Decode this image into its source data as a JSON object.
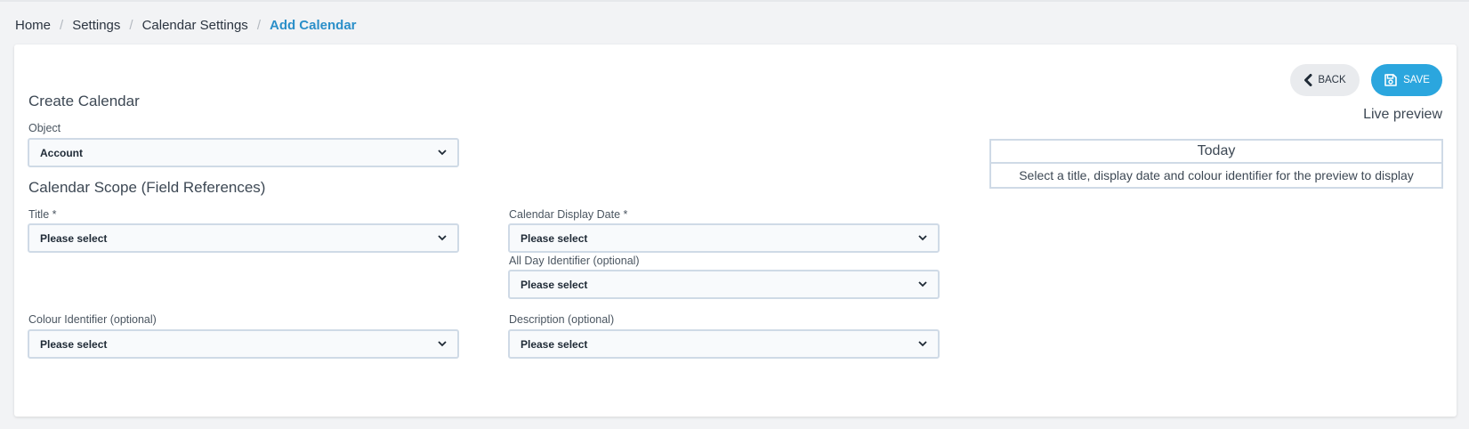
{
  "breadcrumb": {
    "items": [
      "Home",
      "Settings",
      "Calendar Settings"
    ],
    "separator": "/",
    "current": "Add Calendar"
  },
  "toolbar": {
    "back_label": "BACK",
    "save_label": "SAVE"
  },
  "form": {
    "title": "Create Calendar",
    "object_label": "Object",
    "object_value": "Account",
    "scope_title": "Calendar Scope (Field References)",
    "fields": {
      "title": {
        "label": "Title *",
        "value": "Please select"
      },
      "display_date": {
        "label": "Calendar Display Date *",
        "value": "Please select"
      },
      "all_day": {
        "label": "All Day Identifier (optional)",
        "value": "Please select"
      },
      "colour": {
        "label": "Colour Identifier (optional)",
        "value": "Please select"
      },
      "description": {
        "label": "Description (optional)",
        "value": "Please select"
      }
    }
  },
  "preview": {
    "title": "Live preview",
    "header": "Today",
    "message": "Select a title, display date and colour identifier for the preview to display"
  },
  "icons": {
    "back": "chevron-left-icon",
    "save": "floppy-disk-icon",
    "dropdown": "chevron-down-icon"
  },
  "colors": {
    "accent": "#2ba6de",
    "link": "#2b8fc9",
    "border": "#cfdae6"
  }
}
